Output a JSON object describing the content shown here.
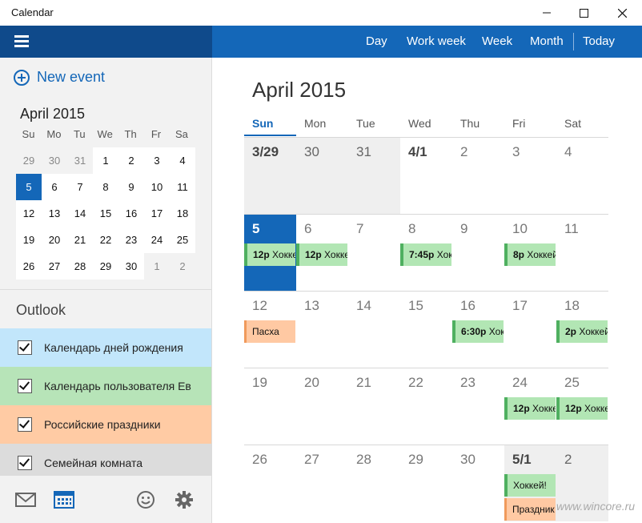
{
  "window": {
    "title": "Calendar"
  },
  "nav": {
    "day": "Day",
    "work_week": "Work week",
    "week": "Week",
    "month": "Month",
    "today": "Today"
  },
  "sidebar": {
    "new_event": "New event",
    "mini": {
      "title": "April 2015",
      "dow": [
        "Su",
        "Mo",
        "Tu",
        "We",
        "Th",
        "Fr",
        "Sa"
      ],
      "days": [
        "29",
        "30",
        "31",
        "1",
        "2",
        "3",
        "4",
        "5",
        "6",
        "7",
        "8",
        "9",
        "10",
        "11",
        "12",
        "13",
        "14",
        "15",
        "16",
        "17",
        "18",
        "19",
        "20",
        "21",
        "22",
        "23",
        "24",
        "25",
        "26",
        "27",
        "28",
        "29",
        "30",
        "1",
        "2"
      ]
    },
    "group": "Outlook",
    "calendars": [
      {
        "name": "Календарь дней рождения",
        "color": "#c2e6fb"
      },
      {
        "name": "Календарь пользователя Ев",
        "color": "#b7e4b8"
      },
      {
        "name": "Российские праздники",
        "color": "#ffcba4"
      },
      {
        "name": "Семейная комната",
        "color": "#dcdcdc"
      }
    ]
  },
  "main": {
    "title": "April 2015",
    "dow": [
      "Sun",
      "Mon",
      "Tue",
      "Wed",
      "Thu",
      "Fri",
      "Sat"
    ],
    "days": [
      "3/29",
      "30",
      "31",
      "4/1",
      "2",
      "3",
      "4",
      "5",
      "6",
      "7",
      "8",
      "9",
      "10",
      "11",
      "12",
      "13",
      "14",
      "15",
      "16",
      "17",
      "18",
      "19",
      "20",
      "21",
      "22",
      "23",
      "24",
      "25",
      "26",
      "27",
      "28",
      "29",
      "30",
      "5/1",
      "2"
    ],
    "events": [
      {
        "day_index": 7,
        "slot": 0,
        "time": "12p",
        "title": "Хоккей",
        "color": "green"
      },
      {
        "day_index": 8,
        "slot": 0,
        "time": "12p",
        "title": "Хоккей",
        "color": "green"
      },
      {
        "day_index": 10,
        "slot": 0,
        "time": "7:45p",
        "title": "Хоккей",
        "color": "green"
      },
      {
        "day_index": 12,
        "slot": 0,
        "time": "8p",
        "title": "Хоккей",
        "color": "green"
      },
      {
        "day_index": 14,
        "slot": 0,
        "time": "",
        "title": "Пасха",
        "color": "orange"
      },
      {
        "day_index": 18,
        "slot": 0,
        "time": "6:30p",
        "title": "Хоккей",
        "color": "green"
      },
      {
        "day_index": 20,
        "slot": 0,
        "time": "2p",
        "title": "Хоккей",
        "color": "green"
      },
      {
        "day_index": 26,
        "slot": 0,
        "time": "12p",
        "title": "Хоккей",
        "color": "green"
      },
      {
        "day_index": 27,
        "slot": 0,
        "time": "12p",
        "title": "Хоккей",
        "color": "green"
      },
      {
        "day_index": 33,
        "slot": 0,
        "time": "",
        "title": "Хоккей!",
        "color": "green"
      },
      {
        "day_index": 33,
        "slot": 1,
        "time": "",
        "title": "Праздник",
        "color": "orange"
      }
    ]
  },
  "watermark": "www.wincore.ru"
}
